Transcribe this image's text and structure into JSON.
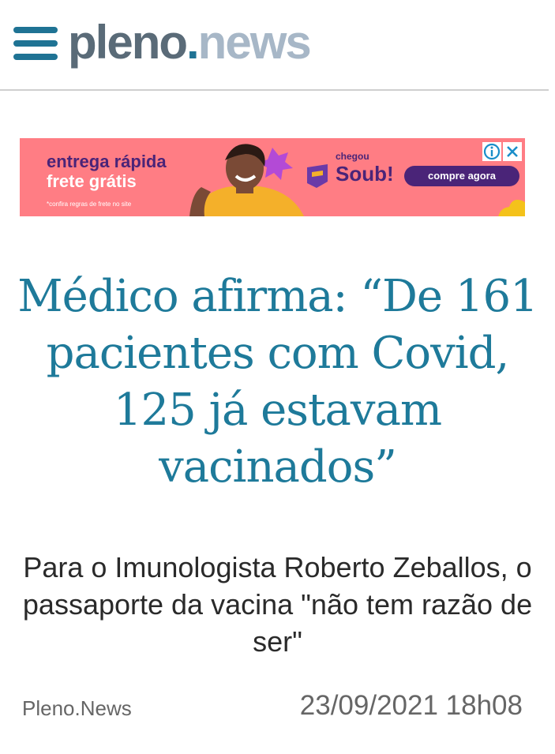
{
  "header": {
    "logo_part1": "pleno",
    "logo_dot": ".",
    "logo_part2": "news"
  },
  "ad": {
    "headline_line1": "entrega rápida",
    "headline_line2": "frete grátis",
    "fine_print": "*confira regras de frete no site",
    "tagline": "chegou",
    "brand": "Soub!",
    "cta": "compre agora",
    "colors": {
      "background": "#ff7d84",
      "brand_purple": "#4a2478"
    }
  },
  "article": {
    "title": "Médico afirma: “De 161 pacientes com Covid, 125 já estavam vacinados”",
    "subtitle": "Para o Imunologista Roberto Zeballos, o passaporte da vacina \"não tem razão de ser\"",
    "source": "Pleno.News",
    "date": "23/09/2021 18h08"
  },
  "colors": {
    "accent": "#1f7394",
    "title": "#1e7a9a",
    "meta_text": "#666666"
  }
}
